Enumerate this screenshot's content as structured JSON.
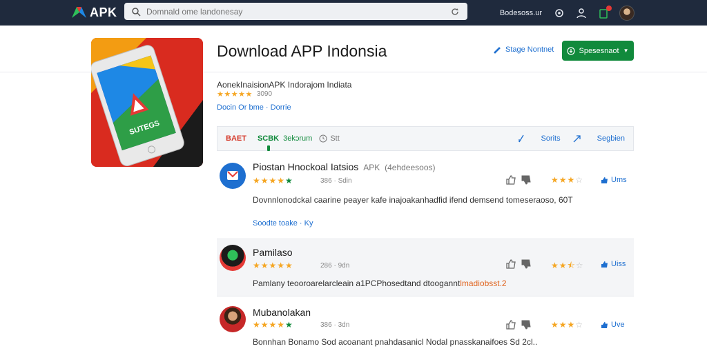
{
  "header": {
    "logo_text": "APK",
    "search_placeholder": "Domnald ome landonesay",
    "top_link": "Bodesoss.ur",
    "colors": {
      "topbar": "#1f2a3d",
      "accent_green": "#118a3c",
      "link_blue": "#1e6fd0"
    }
  },
  "app": {
    "title": "Download APP Indonsia",
    "manage_label": "Stage Nontnet",
    "install_label": "Spesesnaot",
    "subtitle": "AonekInaisionAPK Indorajom Indiata",
    "rating": 4.5,
    "rating_count": "3090",
    "meta_link": "Docin Or bme · Dorrie",
    "hero_label": "SUTEGS"
  },
  "filters": {
    "item1": "BAET",
    "item2": "SCBK",
    "item2_sub": "3ekɔrum",
    "item3": "Stt",
    "sort_label": "Sorits",
    "share_label": "Segbien"
  },
  "reviews": [
    {
      "name": "Piostan Hnockoal Iatsios",
      "name_extra": "APK",
      "name_extra2": "(4ehdeesoos)",
      "rating": 4.5,
      "meta": "386 · Sdin",
      "mini_rating": 3,
      "like": "Ums",
      "body": "Dovnnlonodckal caarine peayer kafe inajoakanhadfid ifend demsend tomeseraoso, 60T",
      "link": "Soodte toake · Ky"
    },
    {
      "name": "Pamilaso",
      "rating": 4.5,
      "meta": "286 · 9dn",
      "mini_rating": 2.5,
      "like": "Uiss",
      "body": "Pamlany teooroarelarcleain a1PCPhosedtand dtoogannt",
      "body_highlight": "lmadiobsst.2"
    },
    {
      "name": "Mubanolakan",
      "rating": 4.5,
      "meta": "386 · 3dn",
      "mini_rating": 3,
      "like": "Uve",
      "body": "Bonnhan Bonamo Sod acoanant pnahdasanicl Nodal pnasskanaifoes Sd 2cl.."
    }
  ]
}
